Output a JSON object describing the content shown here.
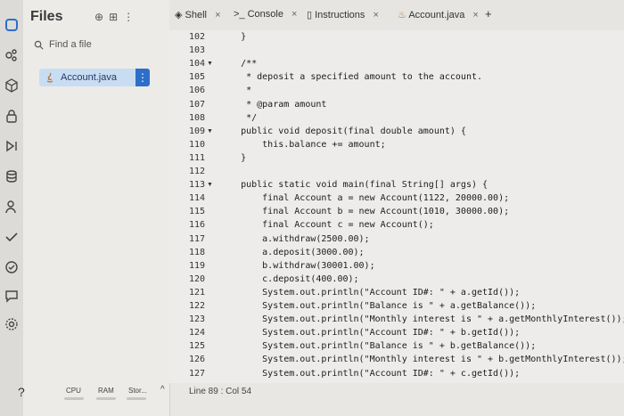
{
  "files_panel": {
    "title": "Files",
    "find_placeholder": "Find a file",
    "active_file": "Account.java",
    "more_glyph": "⋮",
    "tool_glyphs": [
      "⊕",
      "⊞",
      "⋮"
    ]
  },
  "rail_icons": [
    "replit-logo-icon",
    "packages-icon",
    "cube-icon",
    "lock-icon",
    "debugger-icon",
    "database-icon",
    "user-icon",
    "check-icon",
    "shield-icon",
    "chat-icon",
    "settings-icon"
  ],
  "tabs": [
    {
      "label": "Shell",
      "icon": "shell-icon",
      "close": "×"
    },
    {
      "label": "Console",
      "icon": "console-icon",
      "close": "×"
    },
    {
      "label": "Instructions",
      "icon": "book-icon",
      "close": "×"
    },
    {
      "label": "Account.java",
      "icon": "java-file-icon",
      "close": "×"
    }
  ],
  "new_tab_glyph": "+",
  "editor": {
    "lines": [
      {
        "n": "102",
        "fold": "",
        "text": "    }"
      },
      {
        "n": "103",
        "fold": "",
        "text": ""
      },
      {
        "n": "104",
        "fold": "▼",
        "text": "    /**"
      },
      {
        "n": "105",
        "fold": "",
        "text": "     * deposit a specified amount to the account."
      },
      {
        "n": "106",
        "fold": "",
        "text": "     *"
      },
      {
        "n": "107",
        "fold": "",
        "text": "     * @param amount"
      },
      {
        "n": "108",
        "fold": "",
        "text": "     */"
      },
      {
        "n": "109",
        "fold": "▼",
        "text": "    public void deposit(final double amount) {"
      },
      {
        "n": "110",
        "fold": "",
        "text": "        this.balance += amount;"
      },
      {
        "n": "111",
        "fold": "",
        "text": "    }"
      },
      {
        "n": "112",
        "fold": "",
        "text": ""
      },
      {
        "n": "113",
        "fold": "▼",
        "text": "    public static void main(final String[] args) {"
      },
      {
        "n": "114",
        "fold": "",
        "text": "        final Account a = new Account(1122, 20000.00);"
      },
      {
        "n": "115",
        "fold": "",
        "text": "        final Account b = new Account(1010, 30000.00);"
      },
      {
        "n": "116",
        "fold": "",
        "text": "        final Account c = new Account();"
      },
      {
        "n": "117",
        "fold": "",
        "text": "        a.withdraw(2500.00);"
      },
      {
        "n": "118",
        "fold": "",
        "text": "        a.deposit(3000.00);"
      },
      {
        "n": "119",
        "fold": "",
        "text": "        b.withdraw(30001.00);"
      },
      {
        "n": "120",
        "fold": "",
        "text": "        c.deposit(400.00);"
      },
      {
        "n": "121",
        "fold": "",
        "text": "        System.out.println(\"Account ID#: \" + a.getId());"
      },
      {
        "n": "122",
        "fold": "",
        "text": "        System.out.println(\"Balance is \" + a.getBalance());"
      },
      {
        "n": "123",
        "fold": "",
        "text": "        System.out.println(\"Monthly interest is \" + a.getMonthlyInterest());"
      },
      {
        "n": "124",
        "fold": "",
        "text": "        System.out.println(\"Account ID#: \" + b.getId());"
      },
      {
        "n": "125",
        "fold": "",
        "text": "        System.out.println(\"Balance is \" + b.getBalance());"
      },
      {
        "n": "126",
        "fold": "",
        "text": "        System.out.println(\"Monthly interest is \" + b.getMonthlyInterest());"
      },
      {
        "n": "127",
        "fold": "",
        "text": "        System.out.println(\"Account ID#: \" + c.getId());"
      }
    ]
  },
  "status": {
    "help": "?",
    "cpu": "CPU",
    "ram": "RAM",
    "storage": "Stor...",
    "collapse": "^",
    "cursor": "Line 89 : Col 54"
  }
}
